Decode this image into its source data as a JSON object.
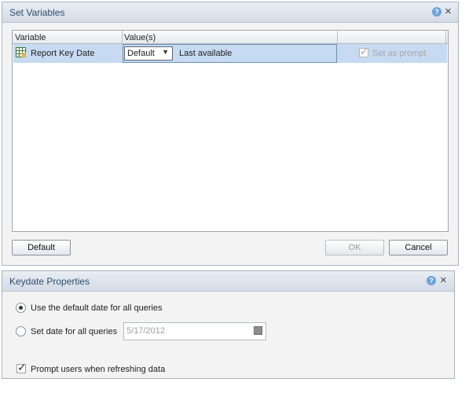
{
  "set_variables": {
    "title": "Set Variables",
    "columns": {
      "variable": "Variable",
      "values": "Value(s)"
    },
    "row": {
      "variable": "Report Key Date",
      "value_select": "Default",
      "value_text": "Last available",
      "set_as_prompt_label": "Set as prompt",
      "set_as_prompt_checked": true
    },
    "buttons": {
      "default": "Default",
      "ok": "OK",
      "cancel": "Cancel"
    }
  },
  "keydate_properties": {
    "title": "Keydate Properties",
    "option_default_label": "Use the default date for all queries",
    "option_set_label": "Set date for all queries",
    "selected_option": "default",
    "date_value": "5/17/2012",
    "prompt_label": "Prompt users when refreshing data",
    "prompt_checked": true
  },
  "icons": {
    "help": "?",
    "close": "×",
    "dropdown": "▼",
    "check": "✓"
  }
}
